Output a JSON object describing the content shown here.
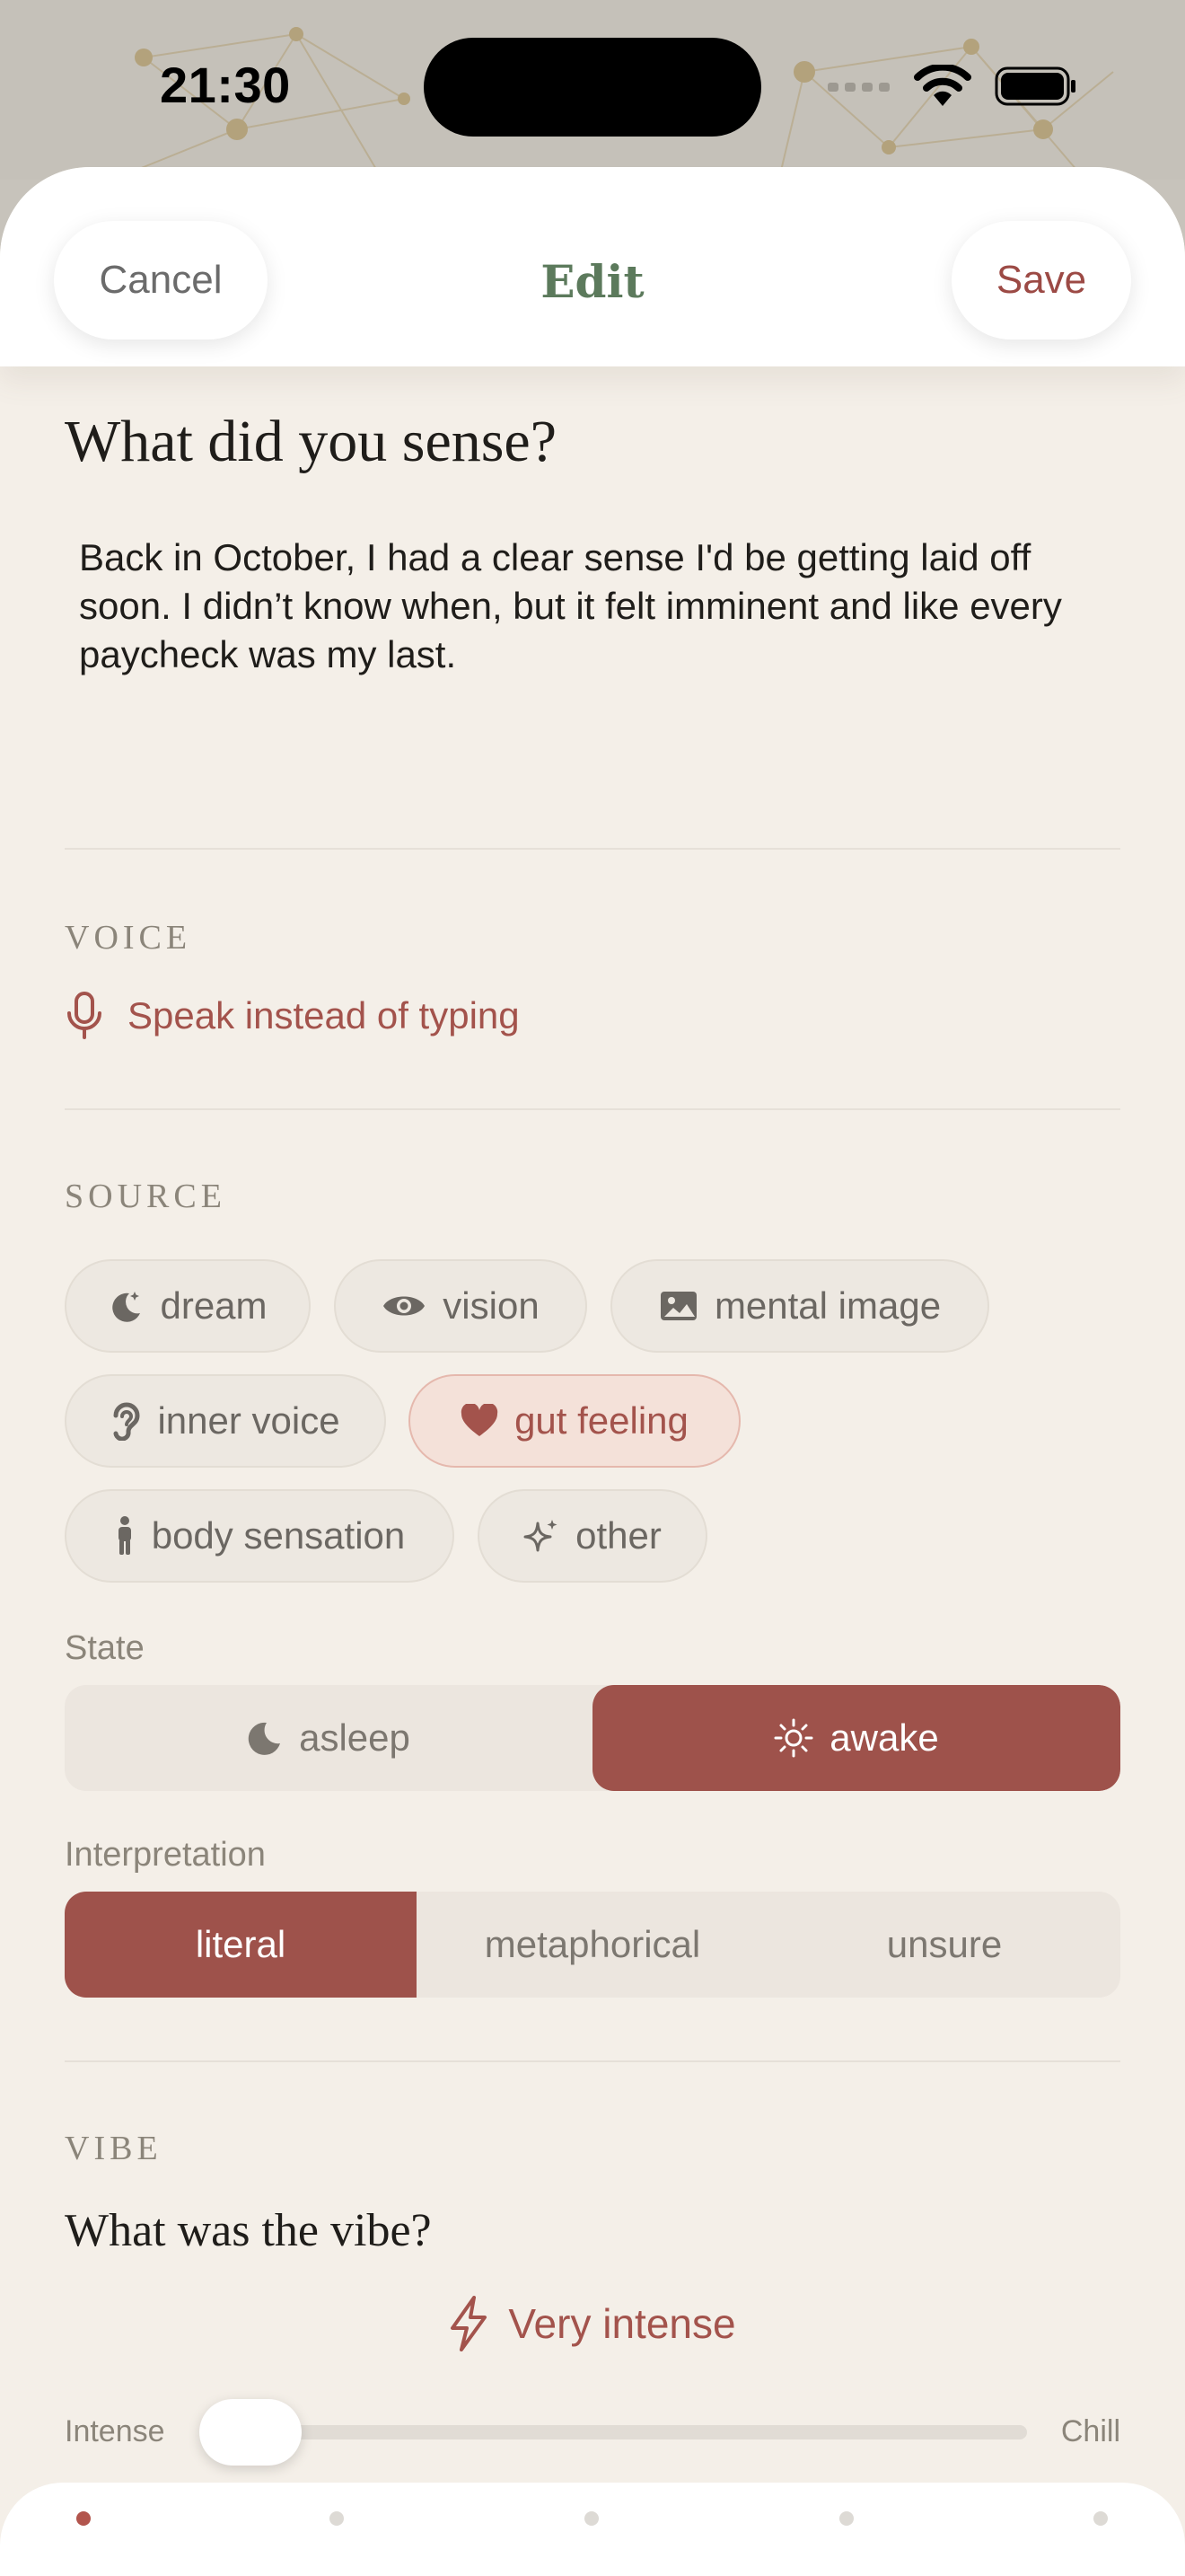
{
  "status_bar": {
    "time": "21:30"
  },
  "nav": {
    "cancel_label": "Cancel",
    "title": "Edit",
    "save_label": "Save"
  },
  "prompt": {
    "heading": "What did you sense?",
    "entry_text": "Back in October, I had a clear sense I'd be getting laid off soon. I didn’t know when, but it felt imminent and like every paycheck was my last."
  },
  "voice": {
    "section_label": "VOICE",
    "action_label": "Speak instead of typing",
    "icon": "microphone-icon"
  },
  "source": {
    "section_label": "SOURCE",
    "chips": [
      {
        "label": "dream",
        "icon": "moon-stars-icon",
        "selected": false
      },
      {
        "label": "vision",
        "icon": "eye-icon",
        "selected": false
      },
      {
        "label": "mental image",
        "icon": "photo-icon",
        "selected": false
      },
      {
        "label": "inner voice",
        "icon": "ear-icon",
        "selected": false
      },
      {
        "label": "gut feeling",
        "icon": "heart-icon",
        "selected": true
      },
      {
        "label": "body sensation",
        "icon": "person-icon",
        "selected": false
      },
      {
        "label": "other",
        "icon": "sparkles-icon",
        "selected": false
      }
    ]
  },
  "state": {
    "label": "State",
    "options": [
      {
        "label": "asleep",
        "icon": "moon-icon",
        "selected": false
      },
      {
        "label": "awake",
        "icon": "sun-icon",
        "selected": true
      }
    ]
  },
  "interpretation": {
    "label": "Interpretation",
    "options": [
      {
        "label": "literal",
        "selected": true
      },
      {
        "label": "metaphorical",
        "selected": false
      },
      {
        "label": "unsure",
        "selected": false
      }
    ]
  },
  "vibe": {
    "section_label": "VIBE",
    "question": "What was the vibe?",
    "intensity_label": "Very intense",
    "intensity_icon": "bolt-icon",
    "slider_min_label": "Intense",
    "slider_max_label": "Chill",
    "slider_value": 0.05
  },
  "pager": {
    "count": 5,
    "active_index": 0
  },
  "colors": {
    "accent": "#9e524b",
    "title_green": "#5c7a5c",
    "background": "#f4efe8"
  }
}
